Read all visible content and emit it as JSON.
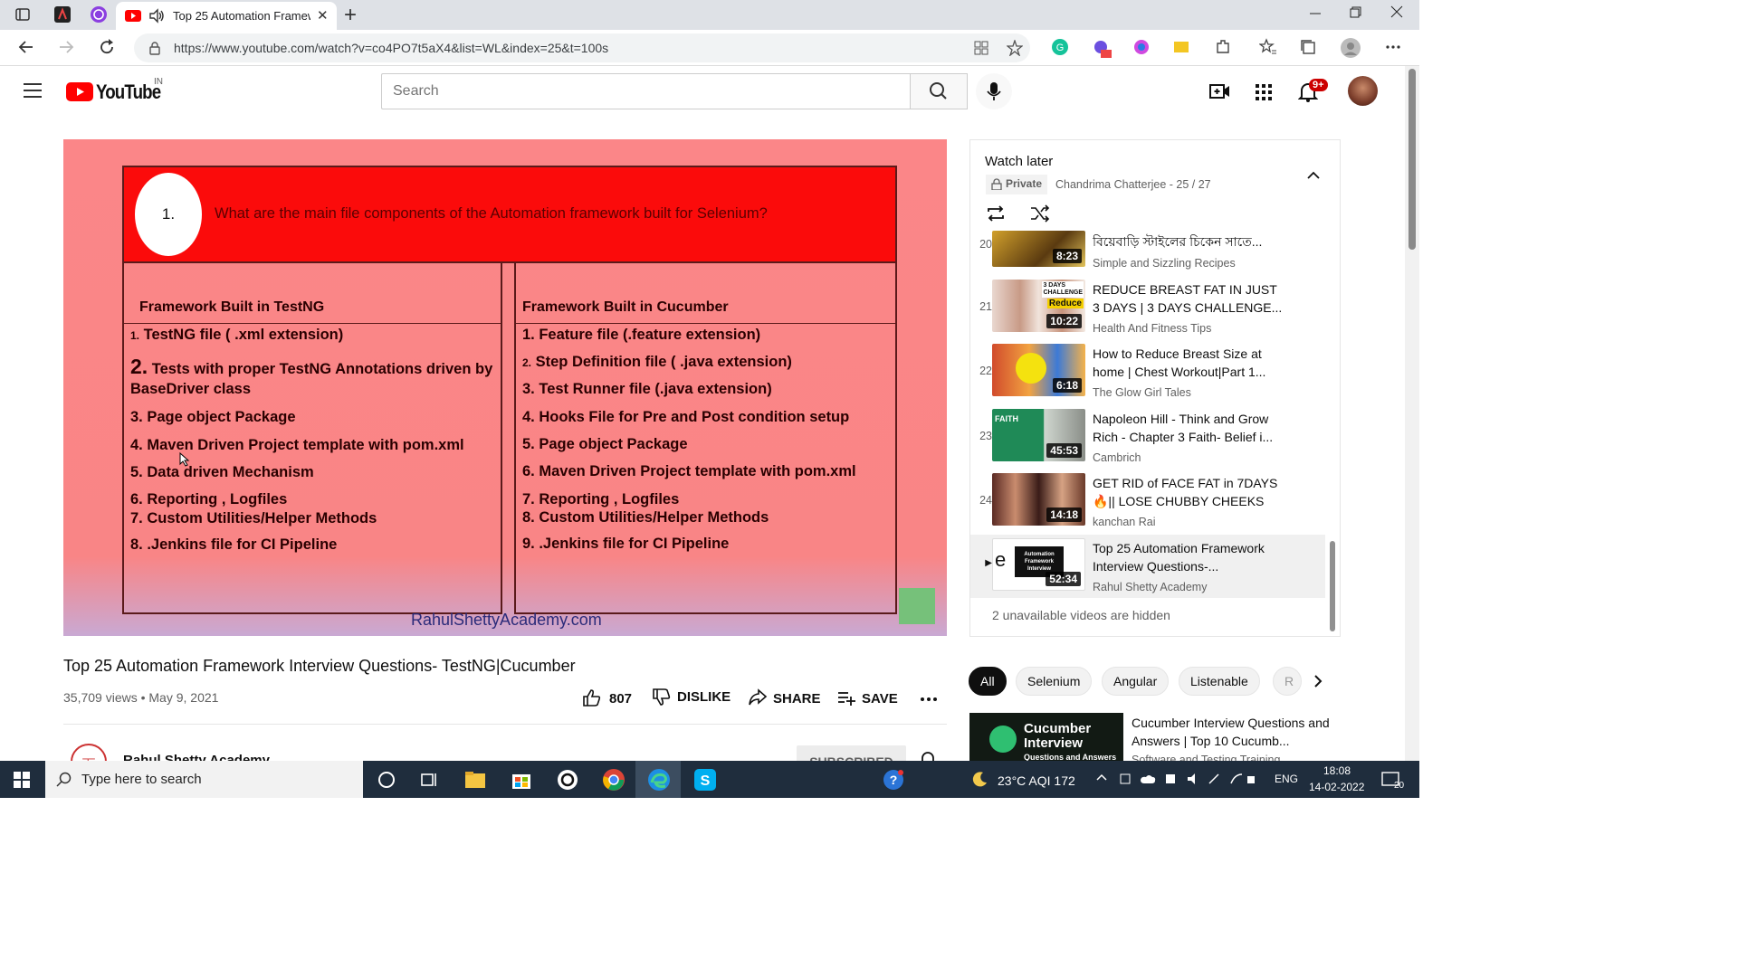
{
  "browser": {
    "active_tab_title": "Top 25 Automation Framew",
    "url": "https://www.youtube.com/watch?v=co4PO7t5aX4&list=WL&index=25&t=100s",
    "new_tab_label": "+",
    "close_tab_label": "✕"
  },
  "youtube": {
    "logo_text": "YouTube",
    "region": "IN",
    "search_placeholder": "Search",
    "notification_count": "9+"
  },
  "video": {
    "slide": {
      "question_number": "1.",
      "question": "What are the main file components of the Automation framework  built for Selenium?",
      "left_heading": "Framework Built in TestNG",
      "left_items": [
        {
          "n": "1.",
          "text": " TestNG file ( .xml extension)"
        },
        {
          "n": "2.",
          "text": " Tests with proper TestNG Annotations driven by BaseDriver class"
        },
        {
          "n": "3.",
          "text": " Page object Package"
        },
        {
          "n": "4.",
          "text": " Maven Driven Project template with pom.xml"
        },
        {
          "n": "5.",
          "text": " Data driven Mechanism"
        },
        {
          "n": "6.",
          "text": " Reporting , Logfiles"
        },
        {
          "n": "7.",
          "text": " Custom Utilities/Helper Methods"
        },
        {
          "n": "8.",
          "text": " .Jenkins file for CI Pipeline"
        }
      ],
      "right_heading": "Framework Built in Cucumber",
      "right_items": [
        {
          "n": "1.",
          "text": "  Feature file (.feature extension)"
        },
        {
          "n": "2.",
          "text": " Step Definition file ( .java extension)"
        },
        {
          "n": "3.",
          "text": " Test Runner file (.java extension)"
        },
        {
          "n": "4.",
          "text": " Hooks File for Pre and Post condition setup"
        },
        {
          "n": "5.",
          "text": " Page object Package"
        },
        {
          "n": "6.",
          "text": " Maven Driven Project template with pom.xml"
        },
        {
          "n": "7.",
          "text": " Reporting , Logfiles"
        },
        {
          "n": "8.",
          "text": " Custom Utilities/Helper Methods"
        },
        {
          "n": "9.",
          "text": " .Jenkins file for CI Pipeline"
        }
      ],
      "site": "RahulShettyAcademy.com"
    },
    "title": "Top 25 Automation Framework Interview Questions- TestNG|Cucumber",
    "meta": "35,709 views • May 9, 2021",
    "likes": "807",
    "dislike_label": "DISLIKE",
    "share_label": "SHARE",
    "save_label": "SAVE",
    "channel": "Rahul Shetty Academy",
    "subscribed_label": "SUBSCRIBED"
  },
  "playlist": {
    "title": "Watch later",
    "privacy": "Private",
    "owner": "Chandrima Chatterjee - 25 / 27",
    "items": [
      {
        "index": "20",
        "title": "বিয়েবাড়ি স্টাইলের চিকেন সাতে...",
        "channel": "Simple and Sizzling Recipes",
        "duration": "8:23"
      },
      {
        "index": "21",
        "title": "REDUCE BREAST FAT IN JUST 3 DAYS | 3 DAYS CHALLENGE...",
        "channel": "Health And Fitness Tips",
        "duration": "10:22"
      },
      {
        "index": "22",
        "title": "How to Reduce Breast Size at home | Chest Workout|Part 1...",
        "channel": "The Glow Girl Tales",
        "duration": "6:18"
      },
      {
        "index": "23",
        "title": "Napoleon Hill - Think and Grow Rich - Chapter 3 Faith- Belief i...",
        "channel": "Cambrich",
        "duration": "45:53"
      },
      {
        "index": "24",
        "title": "GET RID of FACE FAT in 7DAYS 🔥|| LOSE CHUBBY CHEEKS &...",
        "channel": "kanchan Rai",
        "duration": "14:18"
      },
      {
        "index": "▶",
        "title": "Top 25 Automation Framework Interview Questions-...",
        "channel": "Rahul Shetty Academy",
        "duration": "52:34"
      }
    ],
    "hidden_note": "2 unavailable videos are hidden"
  },
  "chips": [
    "All",
    "Selenium",
    "Angular",
    "Listenable",
    "R"
  ],
  "related": {
    "title": "Cucumber Interview Questions and Answers | Top 10 Cucumb...",
    "channel": "Software and Testing Training",
    "thumb_text_1": "Cucumber",
    "thumb_text_2": "Interview",
    "thumb_text_3": "Questions and Answers"
  },
  "taskbar": {
    "search_placeholder": "Type here to search",
    "weather": "23°C  AQI 172",
    "lang": "ENG",
    "time": "18:08",
    "date": "14-02-2022",
    "notif_count": "20"
  },
  "colors": {
    "yt_red": "#ff0000",
    "slide_bg": "#fb8688",
    "slide_header": "#fb0b0b",
    "taskbar": "#1f2d3d"
  }
}
